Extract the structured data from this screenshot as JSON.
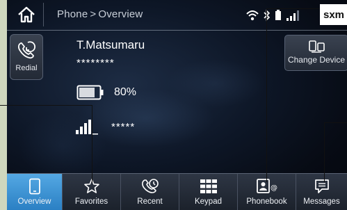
{
  "statusbar": {
    "breadcrumb_root": "Phone",
    "breadcrumb_separator": ">",
    "breadcrumb_current": "Overview",
    "radio_badge": "sxm"
  },
  "left_panel": {
    "redial_label": "Redial"
  },
  "device": {
    "name": "T.Matsumaru",
    "number_masked": "********",
    "battery_percent": "80%",
    "battery_level": 0.8,
    "signal_masked": "*****",
    "signal_bars": 4
  },
  "change_device_label": "Change Device",
  "nav": {
    "items": [
      {
        "label": "Overview",
        "icon": "phone-icon",
        "active": true
      },
      {
        "label": "Favorites",
        "icon": "star-icon",
        "active": false
      },
      {
        "label": "Recent",
        "icon": "recent-calls-icon",
        "active": false
      },
      {
        "label": "Keypad",
        "icon": "keypad-icon",
        "active": false
      },
      {
        "label": "Phonebook",
        "icon": "phonebook-icon",
        "active": false
      },
      {
        "label": "Messages",
        "icon": "messages-icon",
        "active": false
      }
    ]
  },
  "colors": {
    "active_tab": "#3d95d6",
    "background_margin": "#cfd7be",
    "sxm_badge": "#ffffff"
  }
}
